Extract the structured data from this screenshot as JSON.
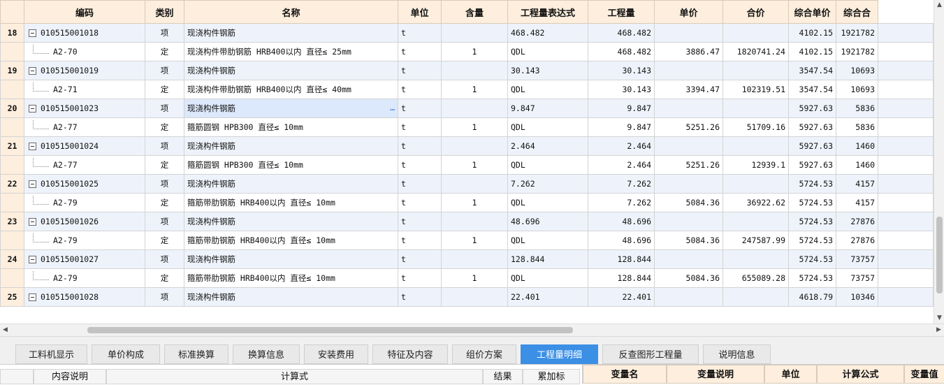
{
  "grid": {
    "headers": [
      "编码",
      "类别",
      "名称",
      "单位",
      "含量",
      "工程量表达式",
      "工程量",
      "单价",
      "合价",
      "综合单价",
      "综合合"
    ],
    "rows": [
      {
        "num": "18",
        "type": "parent",
        "code": "010515001018",
        "cat": "项",
        "name": "现浇构件钢筋",
        "unit": "t",
        "content": "",
        "expr": "468.482",
        "qty": "468.482",
        "price": "",
        "total": "",
        "uprice": "4102.15",
        "utotal": "1921782"
      },
      {
        "num": "",
        "type": "child",
        "code": "A2-70",
        "cat": "定",
        "name": "现浇构件带肋钢筋 HRB400以内 直径≤ 25mm",
        "unit": "t",
        "content": "1",
        "expr": "QDL",
        "qty": "468.482",
        "price": "3886.47",
        "total": "1820741.24",
        "uprice": "4102.15",
        "utotal": "1921782"
      },
      {
        "num": "19",
        "type": "parent",
        "code": "010515001019",
        "cat": "项",
        "name": "现浇构件钢筋",
        "unit": "t",
        "content": "",
        "expr": "30.143",
        "qty": "30.143",
        "price": "",
        "total": "",
        "uprice": "3547.54",
        "utotal": "10693"
      },
      {
        "num": "",
        "type": "child",
        "code": "A2-71",
        "cat": "定",
        "name": "现浇构件带肋钢筋 HRB400以内 直径≤ 40mm",
        "unit": "t",
        "content": "1",
        "expr": "QDL",
        "qty": "30.143",
        "price": "3394.47",
        "total": "102319.51",
        "uprice": "3547.54",
        "utotal": "10693"
      },
      {
        "num": "20",
        "type": "parent",
        "code": "010515001023",
        "cat": "项",
        "name": "现浇构件钢筋",
        "unit": "t",
        "content": "",
        "expr": "9.847",
        "qty": "9.847",
        "price": "",
        "total": "",
        "uprice": "5927.63",
        "utotal": "5836"
      },
      {
        "num": "",
        "type": "child",
        "code": "A2-77",
        "cat": "定",
        "name": "箍筋圆钢 HPB300 直径≤ 10mm",
        "unit": "t",
        "content": "1",
        "expr": "QDL",
        "qty": "9.847",
        "price": "5251.26",
        "total": "51709.16",
        "uprice": "5927.63",
        "utotal": "5836"
      },
      {
        "num": "21",
        "type": "parent",
        "code": "010515001024",
        "cat": "项",
        "name": "现浇构件钢筋",
        "unit": "t",
        "content": "",
        "expr": "2.464",
        "qty": "2.464",
        "price": "",
        "total": "",
        "uprice": "5927.63",
        "utotal": "1460"
      },
      {
        "num": "",
        "type": "child",
        "code": "A2-77",
        "cat": "定",
        "name": "箍筋圆钢 HPB300 直径≤ 10mm",
        "unit": "t",
        "content": "1",
        "expr": "QDL",
        "qty": "2.464",
        "price": "5251.26",
        "total": "12939.1",
        "uprice": "5927.63",
        "utotal": "1460"
      },
      {
        "num": "22",
        "type": "parent",
        "code": "010515001025",
        "cat": "项",
        "name": "现浇构件钢筋",
        "unit": "t",
        "content": "",
        "expr": "7.262",
        "qty": "7.262",
        "price": "",
        "total": "",
        "uprice": "5724.53",
        "utotal": "4157"
      },
      {
        "num": "",
        "type": "child",
        "code": "A2-79",
        "cat": "定",
        "name": "箍筋带肋钢筋 HRB400以内 直径≤ 10mm",
        "unit": "t",
        "content": "1",
        "expr": "QDL",
        "qty": "7.262",
        "price": "5084.36",
        "total": "36922.62",
        "uprice": "5724.53",
        "utotal": "4157"
      },
      {
        "num": "23",
        "type": "parent",
        "code": "010515001026",
        "cat": "项",
        "name": "现浇构件钢筋",
        "unit": "t",
        "content": "",
        "expr": "48.696",
        "qty": "48.696",
        "price": "",
        "total": "",
        "uprice": "5724.53",
        "utotal": "27876"
      },
      {
        "num": "",
        "type": "child",
        "code": "A2-79",
        "cat": "定",
        "name": "箍筋带肋钢筋 HRB400以内 直径≤ 10mm",
        "unit": "t",
        "content": "1",
        "expr": "QDL",
        "qty": "48.696",
        "price": "5084.36",
        "total": "247587.99",
        "uprice": "5724.53",
        "utotal": "27876"
      },
      {
        "num": "24",
        "type": "parent",
        "code": "010515001027",
        "cat": "项",
        "name": "现浇构件钢筋",
        "unit": "t",
        "content": "",
        "expr": "128.844",
        "qty": "128.844",
        "price": "",
        "total": "",
        "uprice": "5724.53",
        "utotal": "73757"
      },
      {
        "num": "",
        "type": "child",
        "code": "A2-79",
        "cat": "定",
        "name": "箍筋带肋钢筋 HRB400以内 直径≤ 10mm",
        "unit": "t",
        "content": "1",
        "expr": "QDL",
        "qty": "128.844",
        "price": "5084.36",
        "total": "655089.28",
        "uprice": "5724.53",
        "utotal": "73757"
      },
      {
        "num": "25",
        "type": "parent",
        "code": "010515001028",
        "cat": "项",
        "name": "现浇构件钢筋",
        "unit": "t",
        "content": "",
        "expr": "22.401",
        "qty": "22.401",
        "price": "",
        "total": "",
        "uprice": "4618.79",
        "utotal": "10346"
      }
    ]
  },
  "tabs": [
    "工料机显示",
    "单价构成",
    "标准换算",
    "换算信息",
    "安装费用",
    "特征及内容",
    "组价方案",
    "工程量明细",
    "反查图形工程量",
    "说明信息"
  ],
  "active_tab": "工程量明细",
  "bottom_left": {
    "headers": [
      "",
      "内容说明",
      "计算式",
      "结果",
      "累加标"
    ]
  },
  "bottom_right": {
    "headers": [
      "变量名",
      "变量说明",
      "单位",
      "计算公式",
      "变量值"
    ]
  },
  "icons": {
    "ellipsis": "…",
    "up": "▲",
    "down": "▼",
    "left": "◀",
    "right": "▶"
  },
  "colors": {
    "header_bg": "#fdeedd",
    "parent_row": "#eef3fb",
    "active_tab": "#3b8fe5",
    "selection": "#3a6fd8"
  }
}
